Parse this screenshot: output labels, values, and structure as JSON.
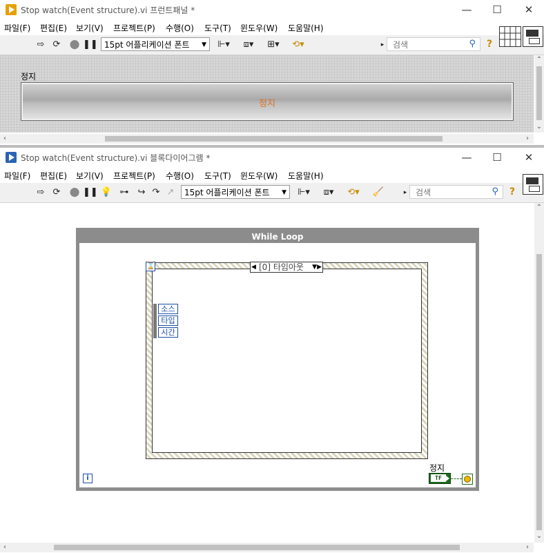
{
  "front_panel": {
    "title": "Stop watch(Event structure).vi 프런트패널 *",
    "menu": [
      "파일(F)",
      "편집(E)",
      "보기(V)",
      "프로젝트(P)",
      "수행(O)",
      "도구(T)",
      "윈도우(W)",
      "도움말(H)"
    ],
    "font_select": "15pt 어플리케이션 폰트",
    "search_placeholder": "검색",
    "stop_label": "정지",
    "stop_button_text": "정지"
  },
  "block_diagram": {
    "title": "Stop watch(Event structure).vi 블록다이어그램 *",
    "menu": [
      "파일(F)",
      "편집(E)",
      "보기(V)",
      "프로젝트(P)",
      "수행(O)",
      "도구(T)",
      "윈도우(W)",
      "도움말(H)"
    ],
    "font_select": "15pt 어플리케이션 폰트",
    "search_placeholder": "검색",
    "while_loop_label": "While Loop",
    "case_selector": "[0] 타임아웃",
    "event_data": [
      "소스",
      "타입",
      "시간"
    ],
    "iteration_terminal": "i",
    "stop_terminal_label": "정지",
    "stop_terminal_text": "TF"
  },
  "window_controls": {
    "minimize": "—",
    "maximize": "☐",
    "close": "✕"
  },
  "colors": {
    "labview_orange": "#e8a000",
    "while_loop_gray": "#8c8c8c",
    "boolean_green": "#1b6b1b",
    "stop_text": "#e07020"
  }
}
